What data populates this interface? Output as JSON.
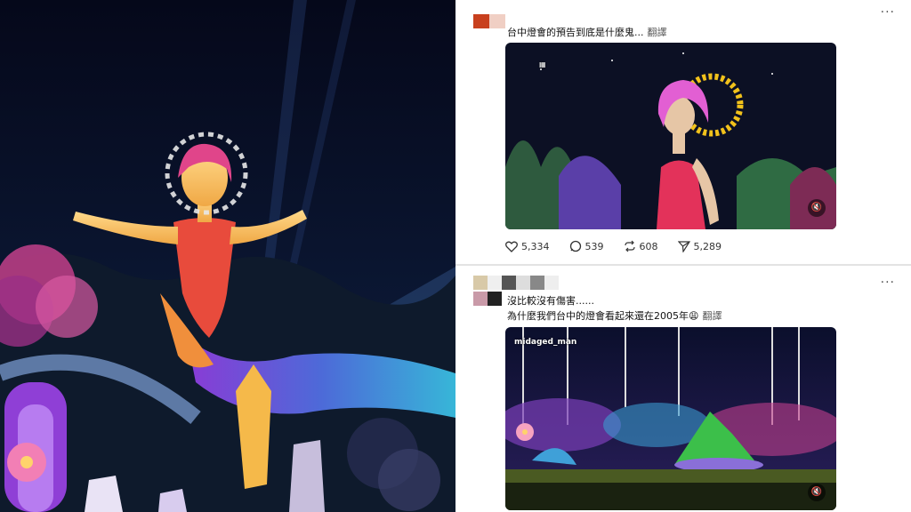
{
  "post1": {
    "text": "台中燈會的預告到底是什麼鬼...",
    "translate": "翻譯",
    "more": "···",
    "mute_icon": "speaker-mute-icon",
    "stats": {
      "likes": "5,334",
      "comments": "539",
      "reposts": "608",
      "shares": "5,289"
    }
  },
  "post2": {
    "line1": "沒比較沒有傷害......",
    "line2": "為什麼我們台中的燈會看起來還在2005年😩",
    "translate": "翻譯",
    "more": "···",
    "watermark": "midaged_man",
    "mute_icon": "speaker-mute-icon"
  },
  "colors": {
    "accent_pink": "#e0458a",
    "night_sky": "#0a0f22",
    "avatar_red": "#c8401e"
  }
}
